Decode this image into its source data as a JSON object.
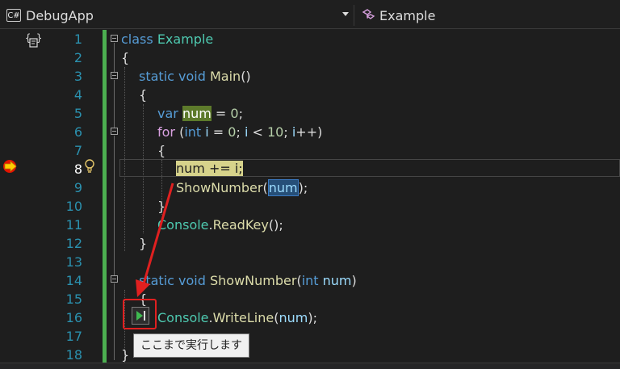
{
  "nav": {
    "project_icon": "C#",
    "project": "DebugApp",
    "class_icon": "class-icon",
    "class_name": "Example"
  },
  "editor": {
    "scope_icon": "scope-icon",
    "current_line": 8,
    "line_numbers": [
      "1",
      "2",
      "3",
      "4",
      "5",
      "6",
      "7",
      "8",
      "9",
      "10",
      "11",
      "12",
      "13",
      "14",
      "15",
      "16",
      "17",
      "18"
    ],
    "lines": {
      "l1": {
        "kw": "class",
        "sp": " ",
        "name": "Example"
      },
      "l2": {
        "text": "{"
      },
      "l3": {
        "k1": "static",
        "k2": "void",
        "name": "Main",
        "rest": "()"
      },
      "l4": {
        "text": "{"
      },
      "l5": {
        "kw": "var",
        "var": "num",
        "rest": " = ",
        "num": "0",
        "end": ";"
      },
      "l6": {
        "kw": "for",
        "p1": " (",
        "kw2": "int",
        "var": " i",
        "eq": " = ",
        "n0": "0",
        "s1": "; ",
        "v2": "i",
        "lt": " < ",
        "n10": "10",
        "s2": "; ",
        "v3": "i",
        "end": "++)"
      },
      "l7": {
        "text": "{"
      },
      "l8": {
        "stmt": "num += i;"
      },
      "l9": {
        "fn": "ShowNumber",
        "p": "(",
        "arg": "num",
        "end": ");"
      },
      "l10": {
        "text": "}"
      },
      "l11": {
        "ty": "Console",
        "dot": ".",
        "fn": "ReadKey",
        "end": "();"
      },
      "l12": {
        "text": "}"
      },
      "l13": {
        "text": ""
      },
      "l14": {
        "k1": "static",
        "k2": "void",
        "name": "ShowNumber",
        "p": "(",
        "kw": "int",
        "arg": "num",
        "end": ")"
      },
      "l15": {
        "text": "{"
      },
      "l16": {
        "ty": "Console",
        "dot": ".",
        "fn": "WriteLine",
        "p": "(",
        "arg": "num",
        "end": ");"
      },
      "l17": {
        "text": ""
      },
      "l18": {
        "text": "}"
      }
    }
  },
  "tooltip": {
    "text": "ここまで実行します"
  },
  "colors": {
    "keyword": "#569cd6",
    "control": "#d8a0df",
    "type": "#4ec9b0",
    "function": "#dcdcaa",
    "variable": "#9cdcfe",
    "number": "#b5cea8",
    "change_bar": "#4caf50",
    "annotation": "#e02020"
  }
}
